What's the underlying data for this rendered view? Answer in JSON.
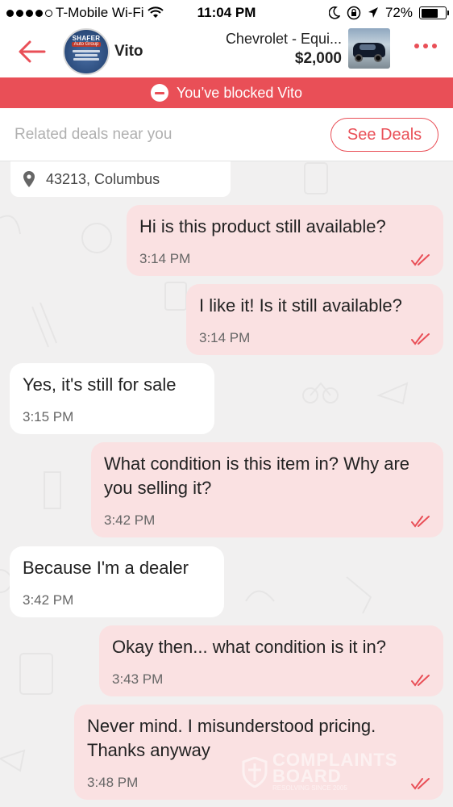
{
  "status_bar": {
    "carrier": "T-Mobile Wi-Fi",
    "time": "11:04 PM",
    "battery": "72%",
    "battery_level": 0.72
  },
  "header": {
    "contact_name": "Vito",
    "listing_title": "Chevrolet - Equi...",
    "listing_price": "$2,000",
    "avatar_text": {
      "line1": "SHAFER",
      "line2": "Auto Group"
    }
  },
  "banner": {
    "blocked_text": "You’ve blocked Vito"
  },
  "deals": {
    "placeholder": "Related deals near you",
    "button_label": "See Deals"
  },
  "location": {
    "text": "43213, Columbus"
  },
  "messages": [
    {
      "direction": "out",
      "text": "Hi is this product still available?",
      "time": "3:14 PM",
      "read": true
    },
    {
      "direction": "out",
      "text": "I like it! Is it still available?",
      "time": "3:14 PM",
      "read": true
    },
    {
      "direction": "in",
      "text": "Yes, it's still for sale",
      "time": "3:15 PM"
    },
    {
      "direction": "out",
      "text": "What condition is this item in? Why are you selling it?",
      "time": "3:42 PM",
      "read": true
    },
    {
      "direction": "in",
      "text": "Because I'm a dealer",
      "time": "3:42 PM"
    },
    {
      "direction": "out",
      "text": "Okay then... what condition is it in?",
      "time": "3:43 PM",
      "read": true
    },
    {
      "direction": "out",
      "text": "Never mind. I misunderstood pricing. Thanks anyway",
      "time": "3:48 PM",
      "read": true
    }
  ],
  "watermark": {
    "line1": "COMPLAINTS",
    "line2": "BOARD",
    "line3": "RESOLVING SINCE 2005"
  },
  "colors": {
    "accent": "#e94f57",
    "outgoing_bubble": "#fae1e2",
    "incoming_bubble": "#ffffff",
    "background": "#f1f0f0"
  }
}
